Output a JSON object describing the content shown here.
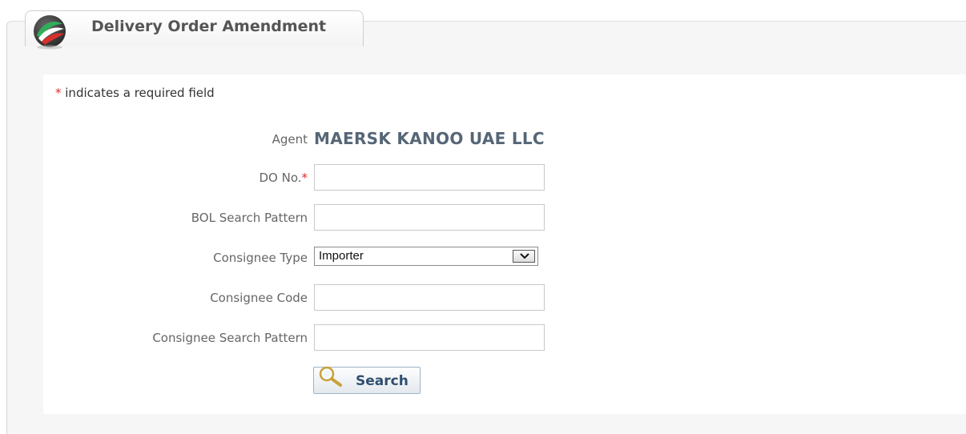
{
  "tab": {
    "title": "Delivery Order Amendment",
    "logo_icon": "dubai-trade-logo-icon"
  },
  "form": {
    "required_note_star": "*",
    "required_note_text": " indicates a required field",
    "agent": {
      "label": "Agent",
      "value": "MAERSK KANOO UAE LLC"
    },
    "do_no": {
      "label": "DO No.",
      "required_star": "*",
      "value": ""
    },
    "bol_search_pattern": {
      "label": "BOL Search Pattern",
      "value": ""
    },
    "consignee_type": {
      "label": "Consignee Type",
      "selected": "Importer"
    },
    "consignee_code": {
      "label": "Consignee Code",
      "value": ""
    },
    "consignee_search_pattern": {
      "label": "Consignee Search Pattern",
      "value": ""
    },
    "search_button": {
      "label": "Search",
      "icon": "magnifier-icon"
    }
  },
  "colors": {
    "required_star": "#d9302c",
    "agent_value": "#556677",
    "panel_bg": "#f6f6f6"
  }
}
